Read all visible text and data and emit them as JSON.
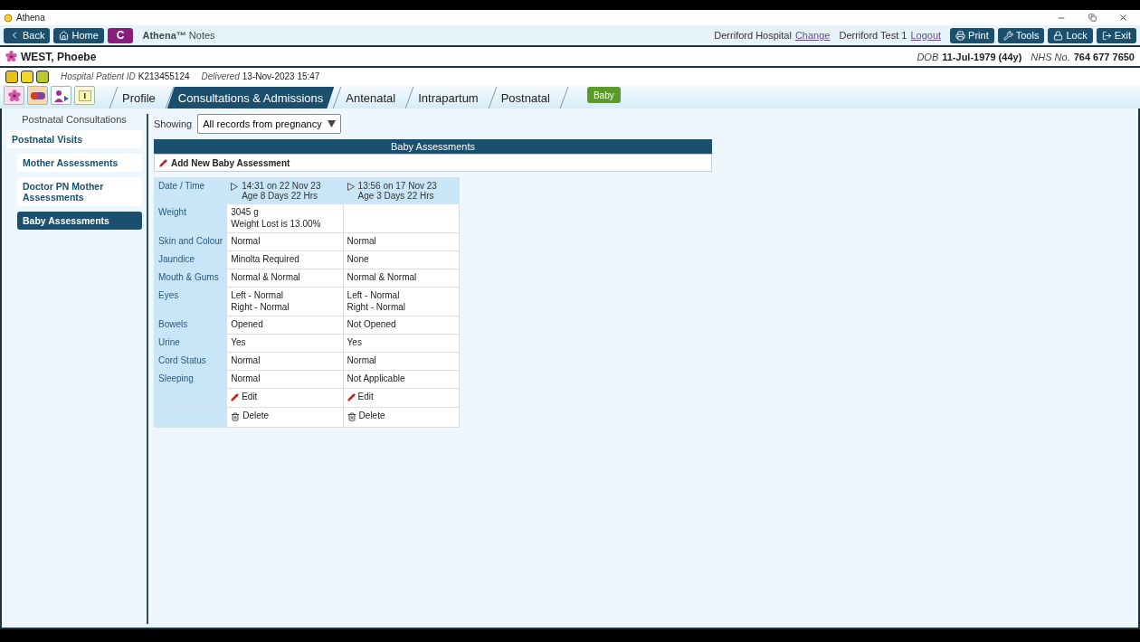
{
  "window": {
    "title": "Athena"
  },
  "toolbar": {
    "nav_buttons": [
      {
        "kind": "back",
        "label": "Back"
      },
      {
        "kind": "home",
        "label": "Home"
      },
      {
        "kind": "letter",
        "label": "C"
      }
    ],
    "app_name": "**Athena™** Notes",
    "hospital": "Derriford Hospital",
    "hospital_link": "Change",
    "user": "Derriford Test 1",
    "user_link": "Logout",
    "action_buttons": [
      {
        "kind": "print",
        "label": "Print"
      },
      {
        "kind": "tools",
        "label": "Tools"
      },
      {
        "kind": "lock",
        "label": "Lock"
      },
      {
        "kind": "exit",
        "label": "Exit"
      }
    ]
  },
  "patient": {
    "name": "WEST, Phoebe",
    "dob_label": "DOB",
    "dob": "11-Jul-1979 (44y)",
    "nhs_label": "NHS No.",
    "nhs": "764 677 7650"
  },
  "info": {
    "id_label": "Hospital Patient ID",
    "id": "K213455124",
    "delivered_label": "Delivered",
    "delivered": "13-Nov-2023 15:47"
  },
  "tabs": [
    {
      "label": "Profile",
      "selected": false
    },
    {
      "label": "Consultations & Admissions",
      "selected": true
    },
    {
      "label": "Antenatal",
      "selected": false
    },
    {
      "label": "Intrapartum",
      "selected": false
    },
    {
      "label": "Postnatal",
      "selected": false
    }
  ],
  "baby_button": "Baby",
  "sidebar": {
    "heading": "Postnatal Consultations",
    "items": [
      {
        "label": "Postnatal Visits",
        "selected": false,
        "children": [
          {
            "label": "Mother Assessments",
            "selected": false
          },
          {
            "label": "Doctor PN Mother Assessments",
            "selected": false
          },
          {
            "label": "Baby Assessments",
            "selected": true
          }
        ]
      }
    ]
  },
  "filter": {
    "label": "Showing",
    "value": "All records from pregnancy"
  },
  "panel": {
    "title": "Baby Assessments",
    "add_link": "Add New Baby Assessment"
  },
  "table": {
    "header_label": "Date / Time",
    "records": [
      {
        "time": "14:31 on 22 Nov 23",
        "age": "Age 8 Days 22 Hrs"
      },
      {
        "time": "13:56 on 17 Nov 23",
        "age": "Age 3 Days 22 Hrs"
      }
    ],
    "rows": [
      {
        "label": "Weight",
        "values": [
          [
            "3045 g",
            "Weight Lost is 13.00%"
          ]
        ]
      },
      {
        "label": "Skin and Colour",
        "values": [
          [
            "Normal"
          ],
          [
            "Normal"
          ]
        ]
      },
      {
        "label": "Jaundice",
        "values": [
          [
            "Minolta Required"
          ],
          [
            "None"
          ]
        ]
      },
      {
        "label": "Mouth & Gums",
        "values": [
          [
            "Normal & Normal"
          ],
          [
            "Normal & Normal"
          ]
        ]
      },
      {
        "label": "Eyes",
        "values": [
          [
            "Left - Normal",
            "Right - Normal"
          ],
          [
            "Left - Normal",
            "Right - Normal"
          ]
        ]
      },
      {
        "label": "Bowels",
        "values": [
          [
            "Opened"
          ],
          [
            "Not Opened"
          ]
        ]
      },
      {
        "label": "Urine",
        "values": [
          [
            "Yes"
          ],
          [
            "Yes"
          ]
        ]
      },
      {
        "label": "Cord Status",
        "values": [
          [
            "Normal"
          ],
          [
            "Normal"
          ]
        ]
      },
      {
        "label": "Sleeping",
        "values": [
          [
            "Normal"
          ],
          [
            "Not Applicable"
          ]
        ]
      }
    ],
    "actions": [
      {
        "kind": "edit",
        "labels": [
          "Edit",
          "Edit"
        ]
      },
      {
        "kind": "delete",
        "labels": [
          "Delete",
          "Delete"
        ]
      }
    ]
  }
}
